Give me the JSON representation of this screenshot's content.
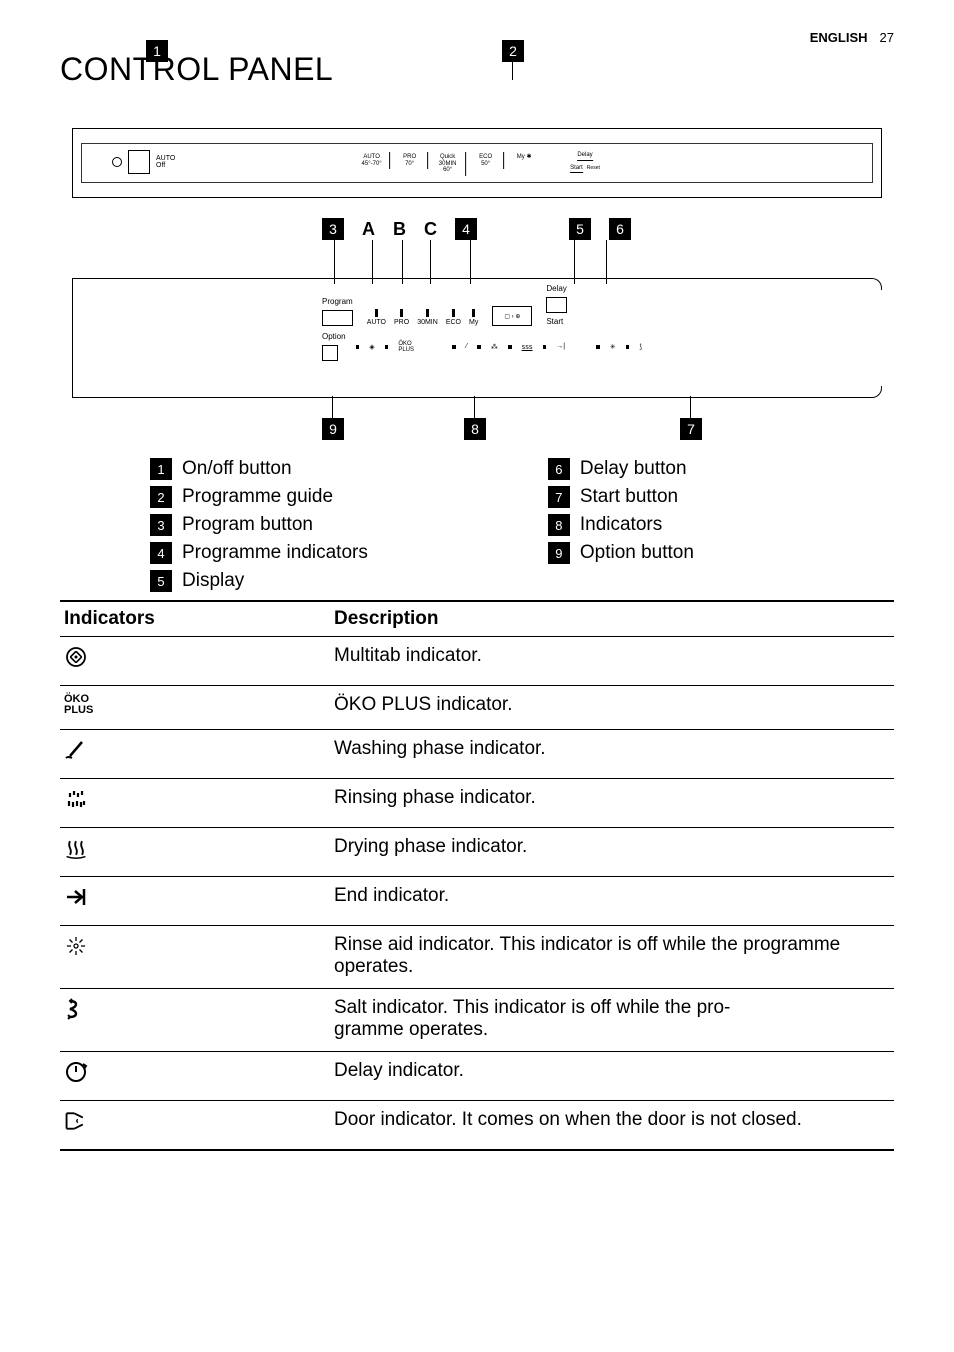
{
  "header": {
    "lang": "ENGLISH",
    "page": "27"
  },
  "title": "CONTROL PANEL",
  "top_panel": {
    "auto_off_label": "AUTO\nOff",
    "guide": {
      "c1_top": "AUTO",
      "c1_bot": "45°-70°",
      "c2_top": "PRO",
      "c2_bot": "70°",
      "c3_top": "Quick",
      "c3_mid": "30MIN",
      "c3_bot": "60°",
      "c4_top": "ECO",
      "c4_bot": "50°",
      "c5_top": "My ✱",
      "right_top": "Delay",
      "right_bot": "Start",
      "reset": "Reset"
    }
  },
  "abc": {
    "a": "A",
    "b": "B",
    "c": "C"
  },
  "cluster": {
    "program": "Program",
    "auto": "AUTO",
    "pro": "PRO",
    "thirty": "30MIN",
    "eco": "ECO",
    "my": "My",
    "delay": "Delay",
    "start": "Start",
    "option": "Option",
    "oko": "ÖKO\nPLUS"
  },
  "legend": [
    {
      "n": "1",
      "text": "On/off button"
    },
    {
      "n": "2",
      "text": "Programme guide"
    },
    {
      "n": "3",
      "text": "Program button"
    },
    {
      "n": "4",
      "text": "Programme indicators"
    },
    {
      "n": "5",
      "text": "Display"
    },
    {
      "n": "6",
      "text": "Delay button"
    },
    {
      "n": "7",
      "text": "Start button"
    },
    {
      "n": "8",
      "text": "Indicators"
    },
    {
      "n": "9",
      "text": "Option button"
    }
  ],
  "table": {
    "h1": "Indicators",
    "h2": "Description",
    "rows": [
      {
        "icon": "multitab",
        "desc": "Multitab indicator."
      },
      {
        "icon": "oko",
        "desc": "ÖKO PLUS indicator."
      },
      {
        "icon": "wash",
        "desc": "Washing phase indicator."
      },
      {
        "icon": "rinse",
        "desc": "Rinsing phase indicator."
      },
      {
        "icon": "dry",
        "desc": "Drying phase indicator."
      },
      {
        "icon": "end",
        "desc": "End indicator."
      },
      {
        "icon": "rinseaid",
        "desc": "Rinse aid indicator. This indicator is off while the programme operates."
      },
      {
        "icon": "salt",
        "desc": "Salt indicator. This indicator is off while the pro-\ngramme operates."
      },
      {
        "icon": "delay",
        "desc": "Delay indicator."
      },
      {
        "icon": "door",
        "desc": "Door indicator. It comes on when the door is not closed."
      }
    ]
  }
}
